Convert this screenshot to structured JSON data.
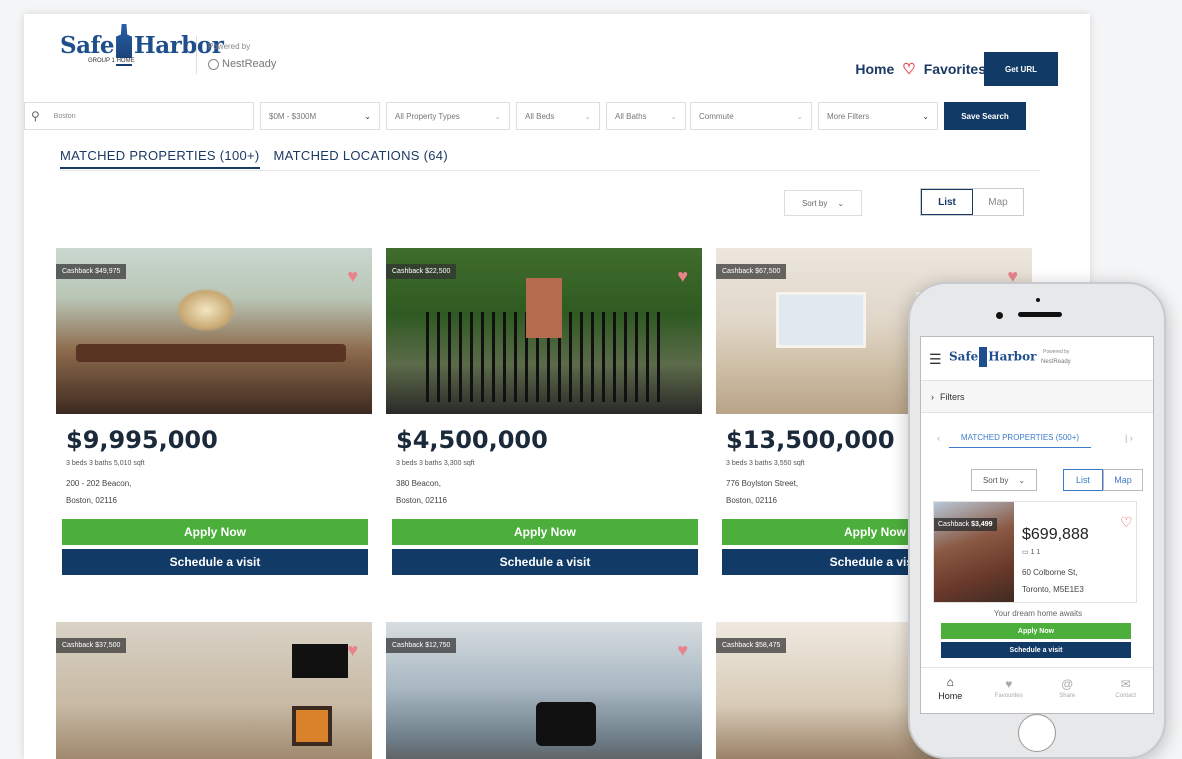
{
  "header": {
    "logo_text_left": "Safe",
    "logo_text_right": "Harbor",
    "logo_sub": "GROUP 1 HOME",
    "powered_by": "Powered by",
    "partner": "NestReady",
    "nav_home": "Home",
    "nav_favorites": "Favorites",
    "get_url": "Get URL"
  },
  "filters": {
    "search_value": "Boston",
    "price": "$0M - $300M",
    "property_types": "All Property Types",
    "beds": "All Beds",
    "baths": "All Baths",
    "commute": "Commute",
    "more_filters": "More Filters",
    "save_search": "Save Search"
  },
  "tabs": {
    "properties": "MATCHED PROPERTIES (100+)",
    "locations": "MATCHED LOCATIONS (64)"
  },
  "controls": {
    "sort_by": "Sort by",
    "list": "List",
    "map": "Map"
  },
  "cards": [
    {
      "cashback": "Cashback $49,975",
      "price": "$9,995,000",
      "meta": "3 beds  3 baths  5,010 sqft",
      "addr1": "200 - 202 Beacon,",
      "addr2": "Boston, 02116",
      "apply": "Apply Now",
      "schedule": "Schedule a visit"
    },
    {
      "cashback": "Cashback $22,500",
      "price": "$4,500,000",
      "meta": "3 beds  3 baths  3,300 sqft",
      "addr1": "380 Beacon,",
      "addr2": "Boston, 02116",
      "apply": "Apply Now",
      "schedule": "Schedule a visit"
    },
    {
      "cashback": "Cashback $67,500",
      "price": "$13,500,000",
      "meta": "3 beds  3 baths  3,550 sqft",
      "addr1": "776 Boylston Street,",
      "addr2": "Boston, 02116",
      "apply": "Apply Now",
      "schedule": "Schedule a visit"
    },
    {
      "cashback": "Cashback $37,500"
    },
    {
      "cashback": "Cashback $12,750"
    },
    {
      "cashback": "Cashback $58,475"
    }
  ],
  "mobile": {
    "filters": "Filters",
    "tab": "MATCHED PROPERTIES (500+)",
    "sort_by": "Sort by",
    "list": "List",
    "map": "Map",
    "cashback_label": "Cashback",
    "cashback_value": "$3,499",
    "price": "$699,888",
    "meta": "1   1",
    "addr1": "60 Colborne St,",
    "addr2": "Toronto, M5E1E3",
    "dream": "Your dream home awaits",
    "apply": "Apply Now",
    "schedule": "Schedule a visit",
    "nav": [
      "Home",
      "Favourites",
      "Share",
      "Contact"
    ]
  },
  "colors": {
    "navy": "#123a66",
    "green": "#4caf3c",
    "heart": "#e0454c",
    "mobile_accent": "#3d7cc9"
  }
}
